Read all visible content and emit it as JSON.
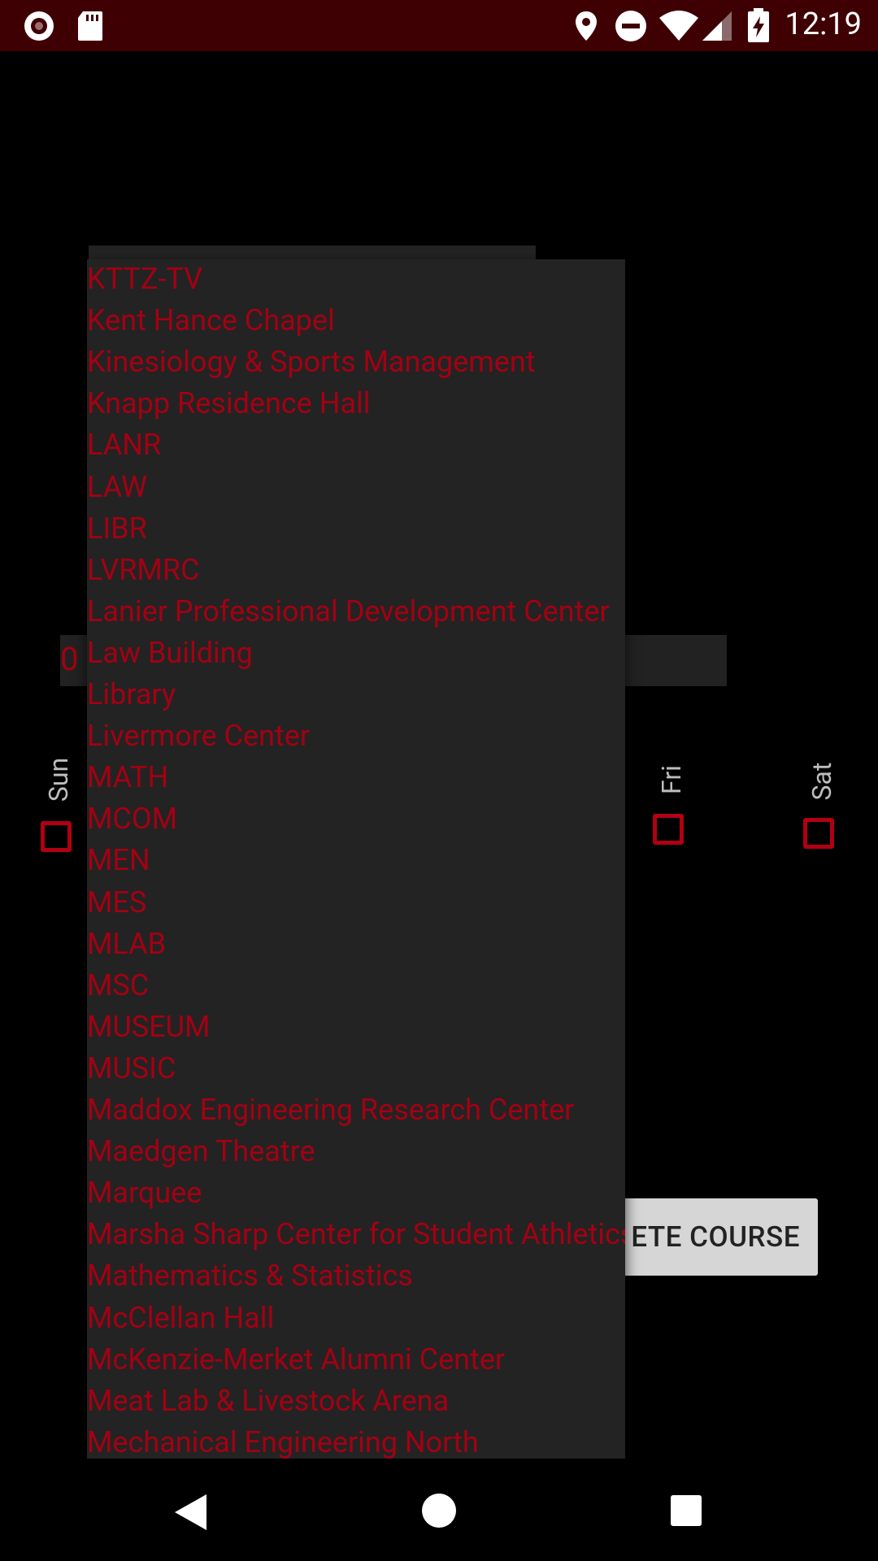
{
  "status_bar": {
    "time": "12:19",
    "icons": [
      "record-icon",
      "sd-card-icon",
      "location-icon",
      "do-not-disturb-icon",
      "wifi-icon",
      "signal-icon",
      "battery-charging-icon"
    ]
  },
  "background_form": {
    "time_field_fragment": "0",
    "days": [
      "Sun",
      "Fri",
      "Sat"
    ],
    "action_button_label": "ETE COURSE"
  },
  "dropdown": {
    "items": [
      "KTTZ-TV",
      "Kent Hance Chapel",
      "Kinesiology & Sports Management",
      "Knapp Residence Hall",
      "LANR",
      "LAW",
      "LIBR",
      "LVRMRC",
      "Lanier Professional Development Center",
      "Law Building",
      "Library",
      "Livermore Center",
      "MATH",
      "MCOM",
      "MEN",
      "MES",
      "MLAB",
      "MSC",
      "MUSEUM",
      "MUSIC",
      "Maddox Engineering Research Center",
      "Maedgen Theatre",
      "Marquee",
      "Marsha Sharp Center for Student Athletics",
      "Mathematics & Statistics",
      "McClellan Hall",
      "McKenzie-Merket Alumni Center",
      "Meat Lab & Livestock Arena",
      "Mechanical Engineering North"
    ]
  },
  "colors": {
    "status_bar": "#3f0004",
    "accent_red": "#a30013",
    "dropdown_bg": "#232323",
    "background": "#000000"
  },
  "nav_bar": {
    "buttons": [
      "back-icon",
      "home-icon",
      "recents-icon"
    ]
  }
}
